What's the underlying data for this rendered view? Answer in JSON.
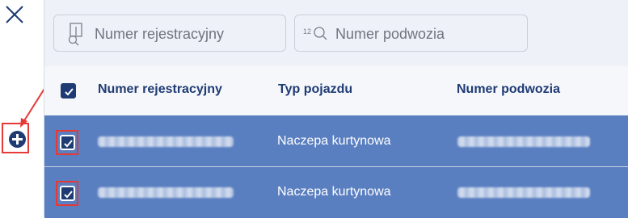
{
  "search": {
    "registration_placeholder": "Numer rejestracyjny",
    "vin_placeholder": "Numer podwozia",
    "vin_icon_text": "12"
  },
  "table": {
    "headers": {
      "registration": "Numer rejestracyjny",
      "type": "Typ pojazdu",
      "vin": "Numer podwozia"
    },
    "rows": [
      {
        "type": "Naczepa kurtynowa",
        "checked": true
      },
      {
        "type": "Naczepa kurtynowa",
        "checked": true
      }
    ],
    "select_all_checked": true
  },
  "colors": {
    "accent": "#1f3b73",
    "row_selected": "#5a7fc0",
    "highlight": "#e53935"
  }
}
